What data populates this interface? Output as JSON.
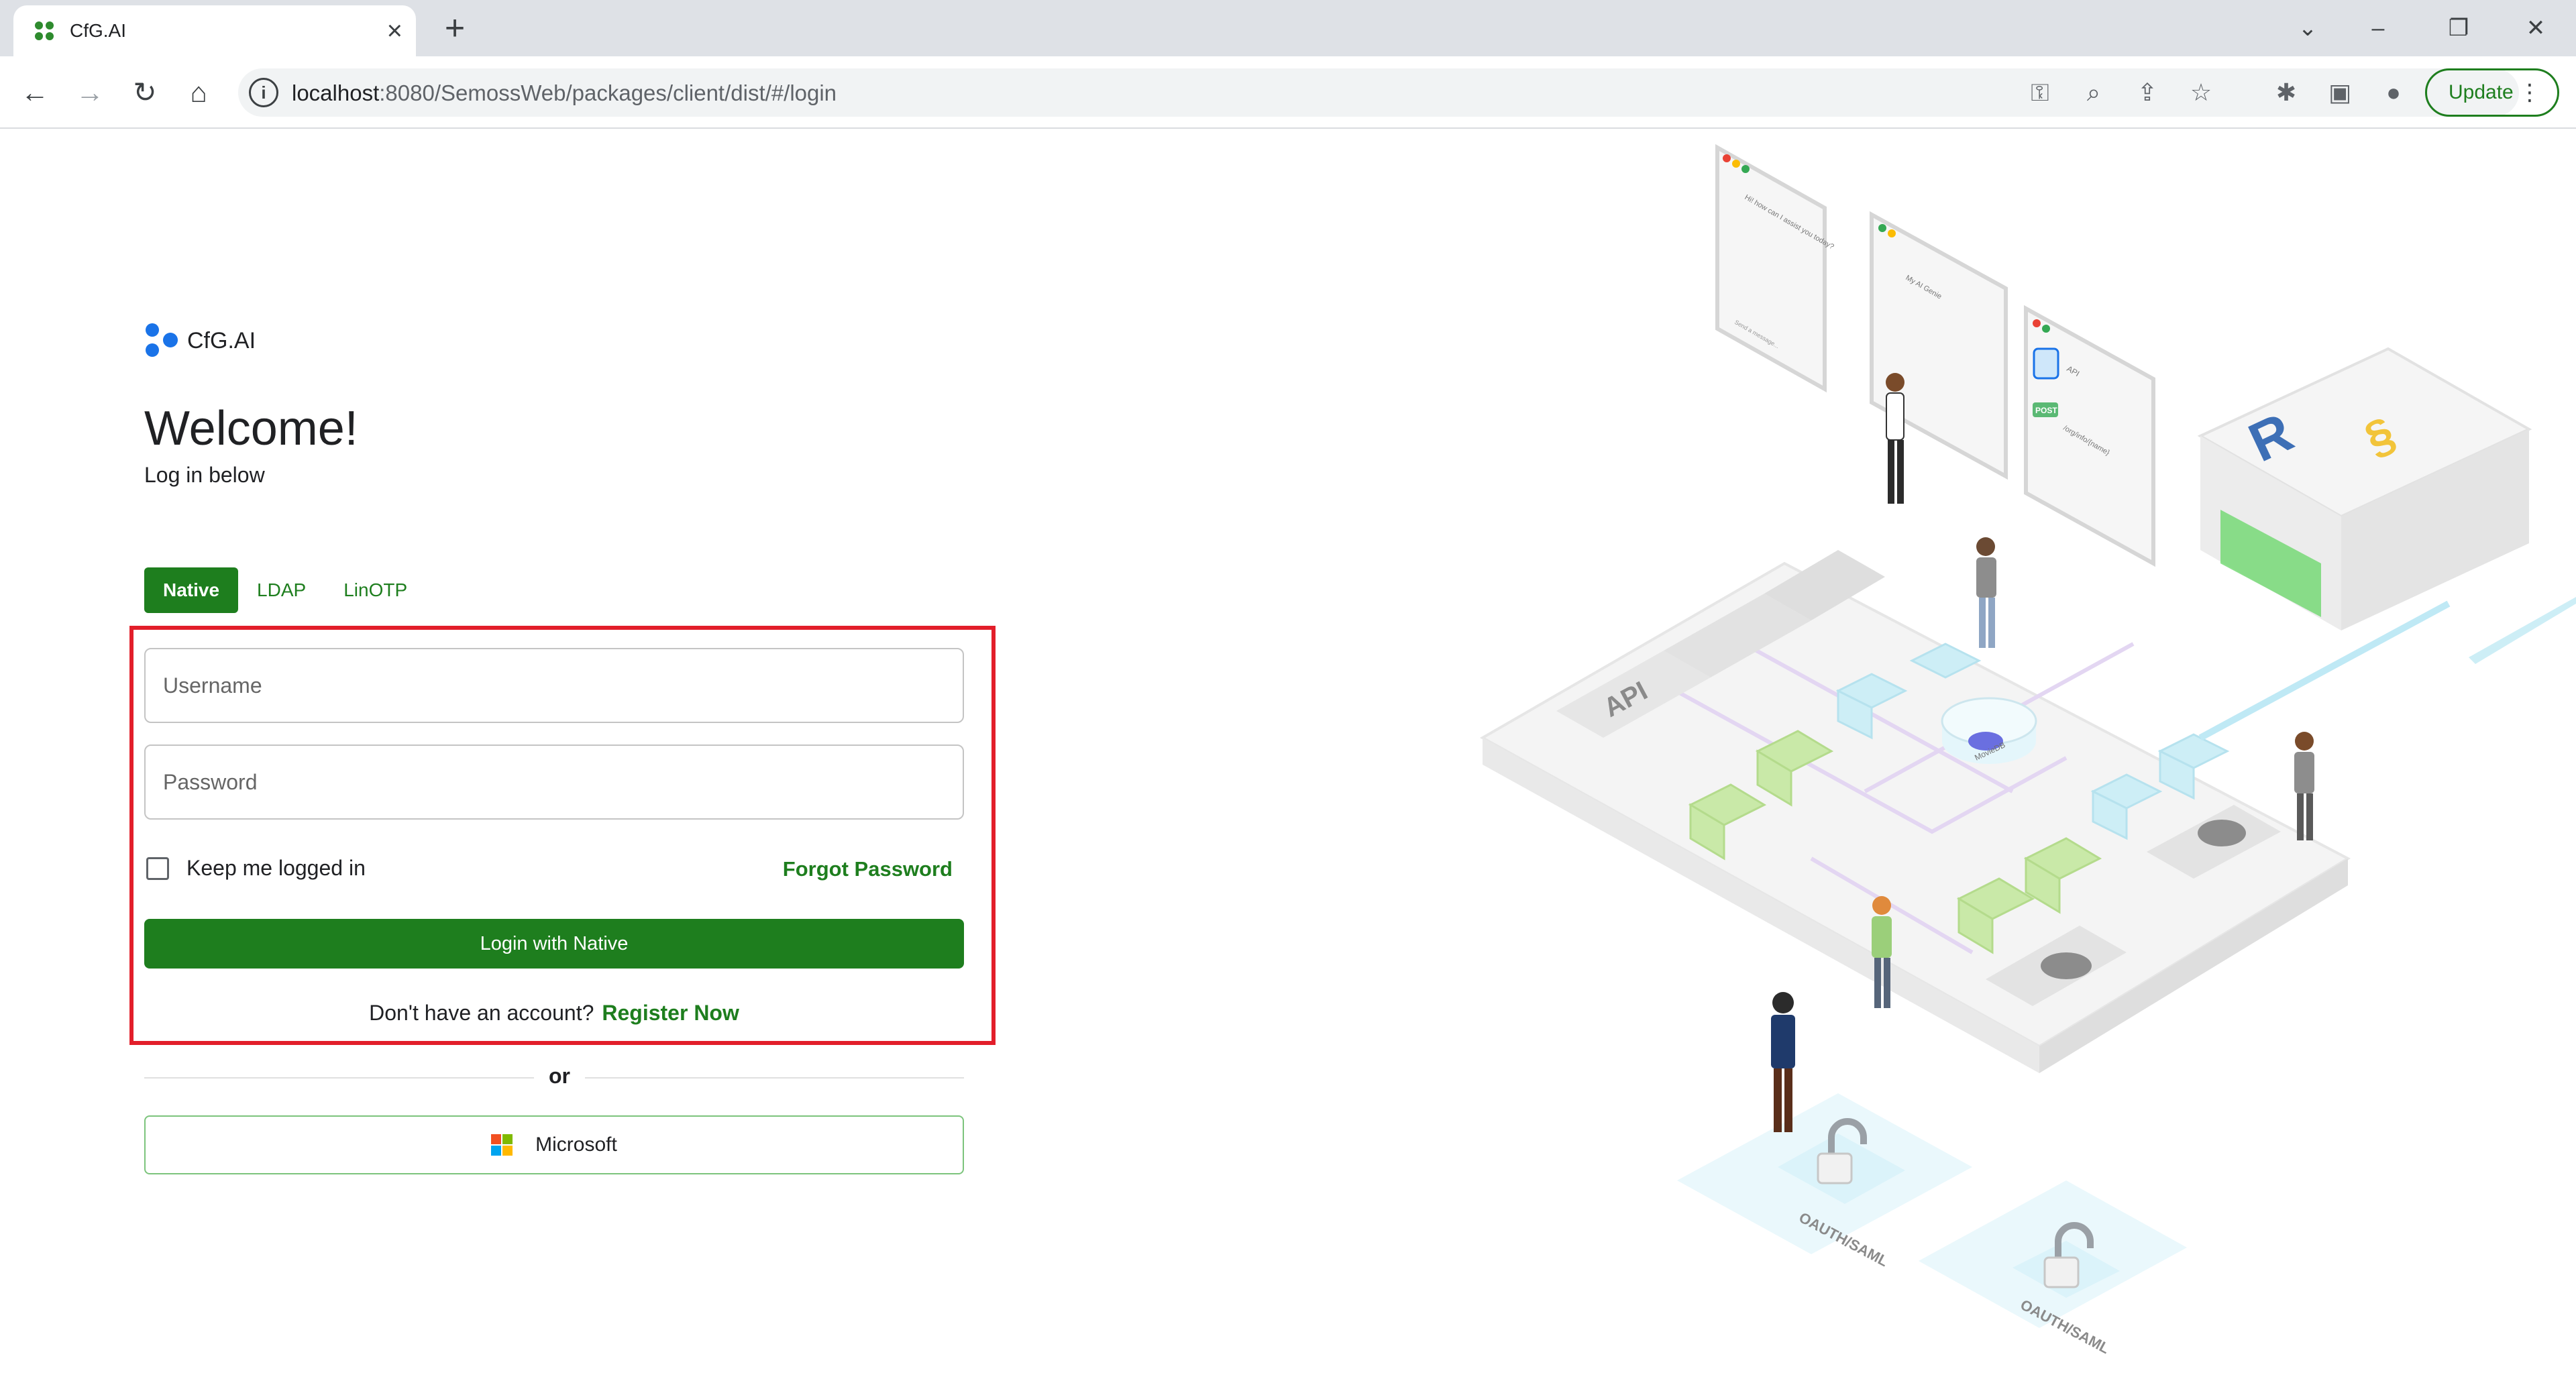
{
  "browser": {
    "tab_title": "CfG.AI",
    "url_host": "localhost",
    "url_path": ":8080/SemossWeb/packages/client/dist/#/login",
    "update_label": "Update"
  },
  "icons": {
    "tab_favicon": "cfg-logo-icon",
    "close": "close-icon",
    "new_tab": "plus-icon",
    "back": "back-arrow-icon",
    "forward": "forward-arrow-icon",
    "reload": "reload-icon",
    "home": "home-icon",
    "site_info": "info-icon",
    "key": "key-icon",
    "zoom": "zoom-icon",
    "share": "share-icon",
    "bookmark": "star-icon",
    "extensions": "puzzle-icon",
    "side_panel": "side-panel-icon",
    "profile": "avatar-icon",
    "menu": "kebab-menu-icon"
  },
  "colors": {
    "brand_green": "#1e7e1e",
    "highlight_red": "#e21e2a",
    "logo_blue": "#1a73e8"
  },
  "page": {
    "logo_text": "CfG.AI",
    "welcome": "Welcome!",
    "subtitle": "Log in below",
    "tabs": [
      {
        "label": "Native",
        "active": true
      },
      {
        "label": "LDAP",
        "active": false
      },
      {
        "label": "LinOTP",
        "active": false
      }
    ],
    "username_placeholder": "Username",
    "password_placeholder": "Password",
    "keep_logged_in": "Keep me logged in",
    "forgot_password": "Forgot Password",
    "login_button": "Login with Native",
    "no_account": "Don't have an account?",
    "register_now": "Register Now",
    "or": "or",
    "microsoft_button": "Microsoft"
  },
  "illustration": {
    "chat_card_text": "Hi! how can I assist you today?",
    "chat_input_text": "Send a message...",
    "genie_card_text": "My AI Genie",
    "api_card_title": "API",
    "api_badge": "POST",
    "api_path": "/org/info/{name}",
    "platform_api_label": "API",
    "database_label": "MovieDB",
    "auth_label_1": "OAUTH/SAML",
    "auth_label_2": "OAUTH/SAML"
  }
}
